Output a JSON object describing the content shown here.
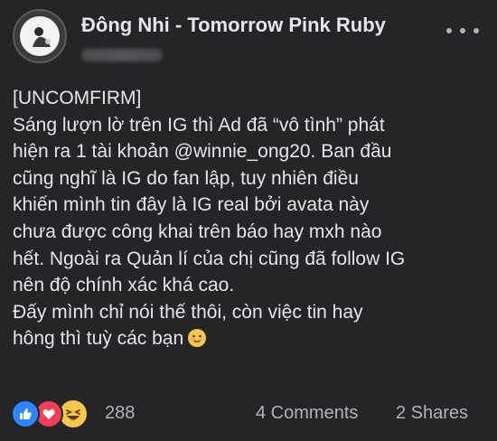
{
  "header": {
    "page_name": "Đông Nhi - Tomorrow Pink Ruby"
  },
  "post": {
    "lines": [
      "[UNCOMFIRM]",
      "Sáng lượn lờ trên IG thì Ad đã “vô tình” phát",
      "hiện ra 1 tài khoản @winnie_ong20. Ban đầu",
      "cũng nghĩ là IG do fan lập, tuy nhiên điều",
      "khiến mình tin đây là IG real bởi avata này",
      "chưa được công khai trên báo hay mxh nào",
      "hết. Ngoài ra Quản lí của chị cũng đã follow IG",
      "nên độ chính xác khá cao.",
      "Đấy mình chỉ nói thế thôi, còn việc tin hay",
      "hông thì tuỳ các bạn"
    ],
    "trailing_emoji": "blush-smile-emoji"
  },
  "footer": {
    "reaction_icons": [
      "like-icon",
      "love-icon",
      "haha-icon"
    ],
    "reaction_count": "288",
    "comments": "4 Comments",
    "shares": "2 Shares"
  },
  "colors": {
    "background": "#242526",
    "text_primary": "#e4e6eb",
    "text_secondary": "#b0b3b8",
    "like": "#2d88ff",
    "love": "#f33e58",
    "haha": "#f7c64d"
  }
}
